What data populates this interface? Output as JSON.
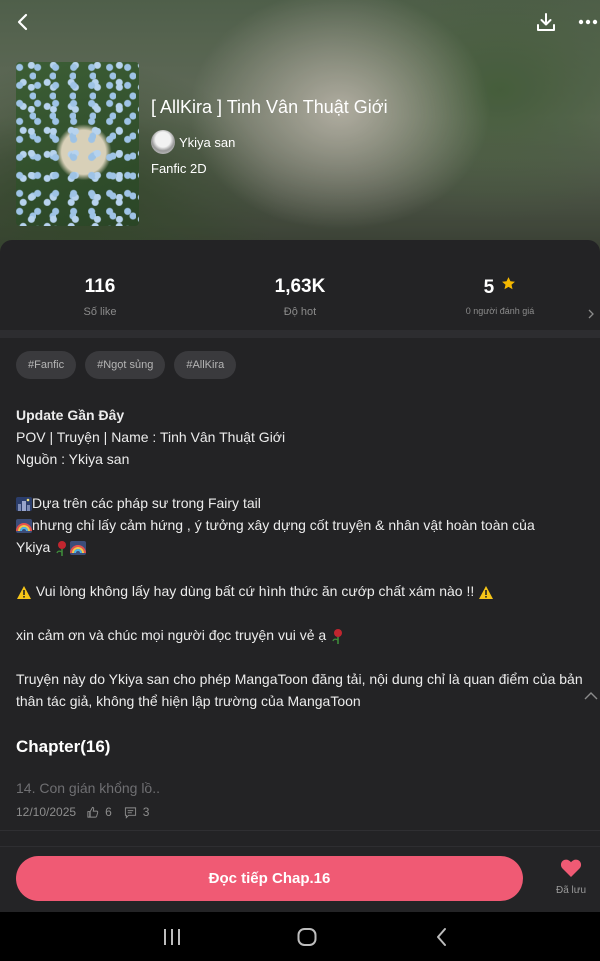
{
  "book": {
    "title": "[ AllKira ] Tinh Vân Thuật Giới",
    "author": "Ykiya san",
    "genre": "Fanfic 2D"
  },
  "stats": [
    {
      "value": "116",
      "label": "Số like"
    },
    {
      "value": "1,63K",
      "label": "Độ hot"
    },
    {
      "value": "5",
      "label": "0 người đánh giá"
    }
  ],
  "tags": [
    "#Fanfic",
    "#Ngọt sủng",
    "#AllKira"
  ],
  "description": {
    "heading": "Update Gần Đây",
    "line1": "POV | Truyện | Name : Tinh Vân Thuật Giới",
    "line2": "Nguồn : Ykiya san",
    "p1_line1": "Dựa trên các pháp sư trong Fairy tail",
    "p1_line2": "nhưng chỉ lấy cảm hứng , ý tưởng xây dựng cốt truyện & nhân vật hoàn toàn của",
    "p1_line3": "Ykiya",
    "warning": "Vui lòng không lấy hay dùng bất cứ hình thức ăn cướp chất xám nào !!",
    "thanks": "xin cảm ơn và chúc mọi người đọc truyện vui vẻ ạ",
    "disclaimer": "Truyện này do Ykiya san cho phép MangaToon đăng tải, nội dung chỉ là quan điểm của bản thân tác giả, không thể hiện lập trường của MangaToon"
  },
  "chapters": {
    "heading": "Chapter(16)",
    "latest": {
      "title": "14. Con gián khổng lồ..",
      "date": "12/10/2025",
      "likes": "6",
      "comments": "3"
    }
  },
  "actions": {
    "read_label": "Đọc tiếp Chap.16",
    "save_label": "Đã lưu"
  },
  "colors": {
    "accent": "#f05a74",
    "star": "#f5b800",
    "background": "#232325"
  },
  "icons": [
    "back-icon",
    "download-icon",
    "more-icon",
    "star-icon",
    "heart-icon",
    "like-icon",
    "comment-icon",
    "chevron-up-icon",
    "chevron-right-icon"
  ]
}
